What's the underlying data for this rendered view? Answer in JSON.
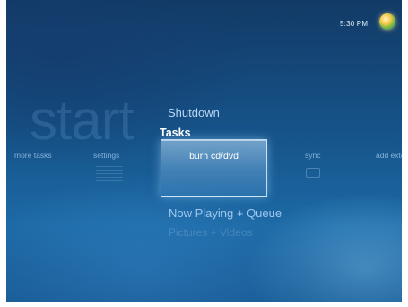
{
  "status": {
    "time": "5:30 PM",
    "orb_icon": "windows-start-orb-icon"
  },
  "watermark": "start",
  "menu": {
    "above": "Shutdown",
    "current": "Tasks",
    "below": "Now Playing + Queue",
    "below2": "Pictures + Videos"
  },
  "strip": {
    "items": [
      "more tasks",
      "settings",
      "burn cd/dvd",
      "sync",
      "add extender"
    ],
    "selected": "burn cd/dvd"
  },
  "colors": {
    "accent": "#1d6aa6",
    "highlight": "#bfe1ff",
    "text": "#ffffff"
  }
}
